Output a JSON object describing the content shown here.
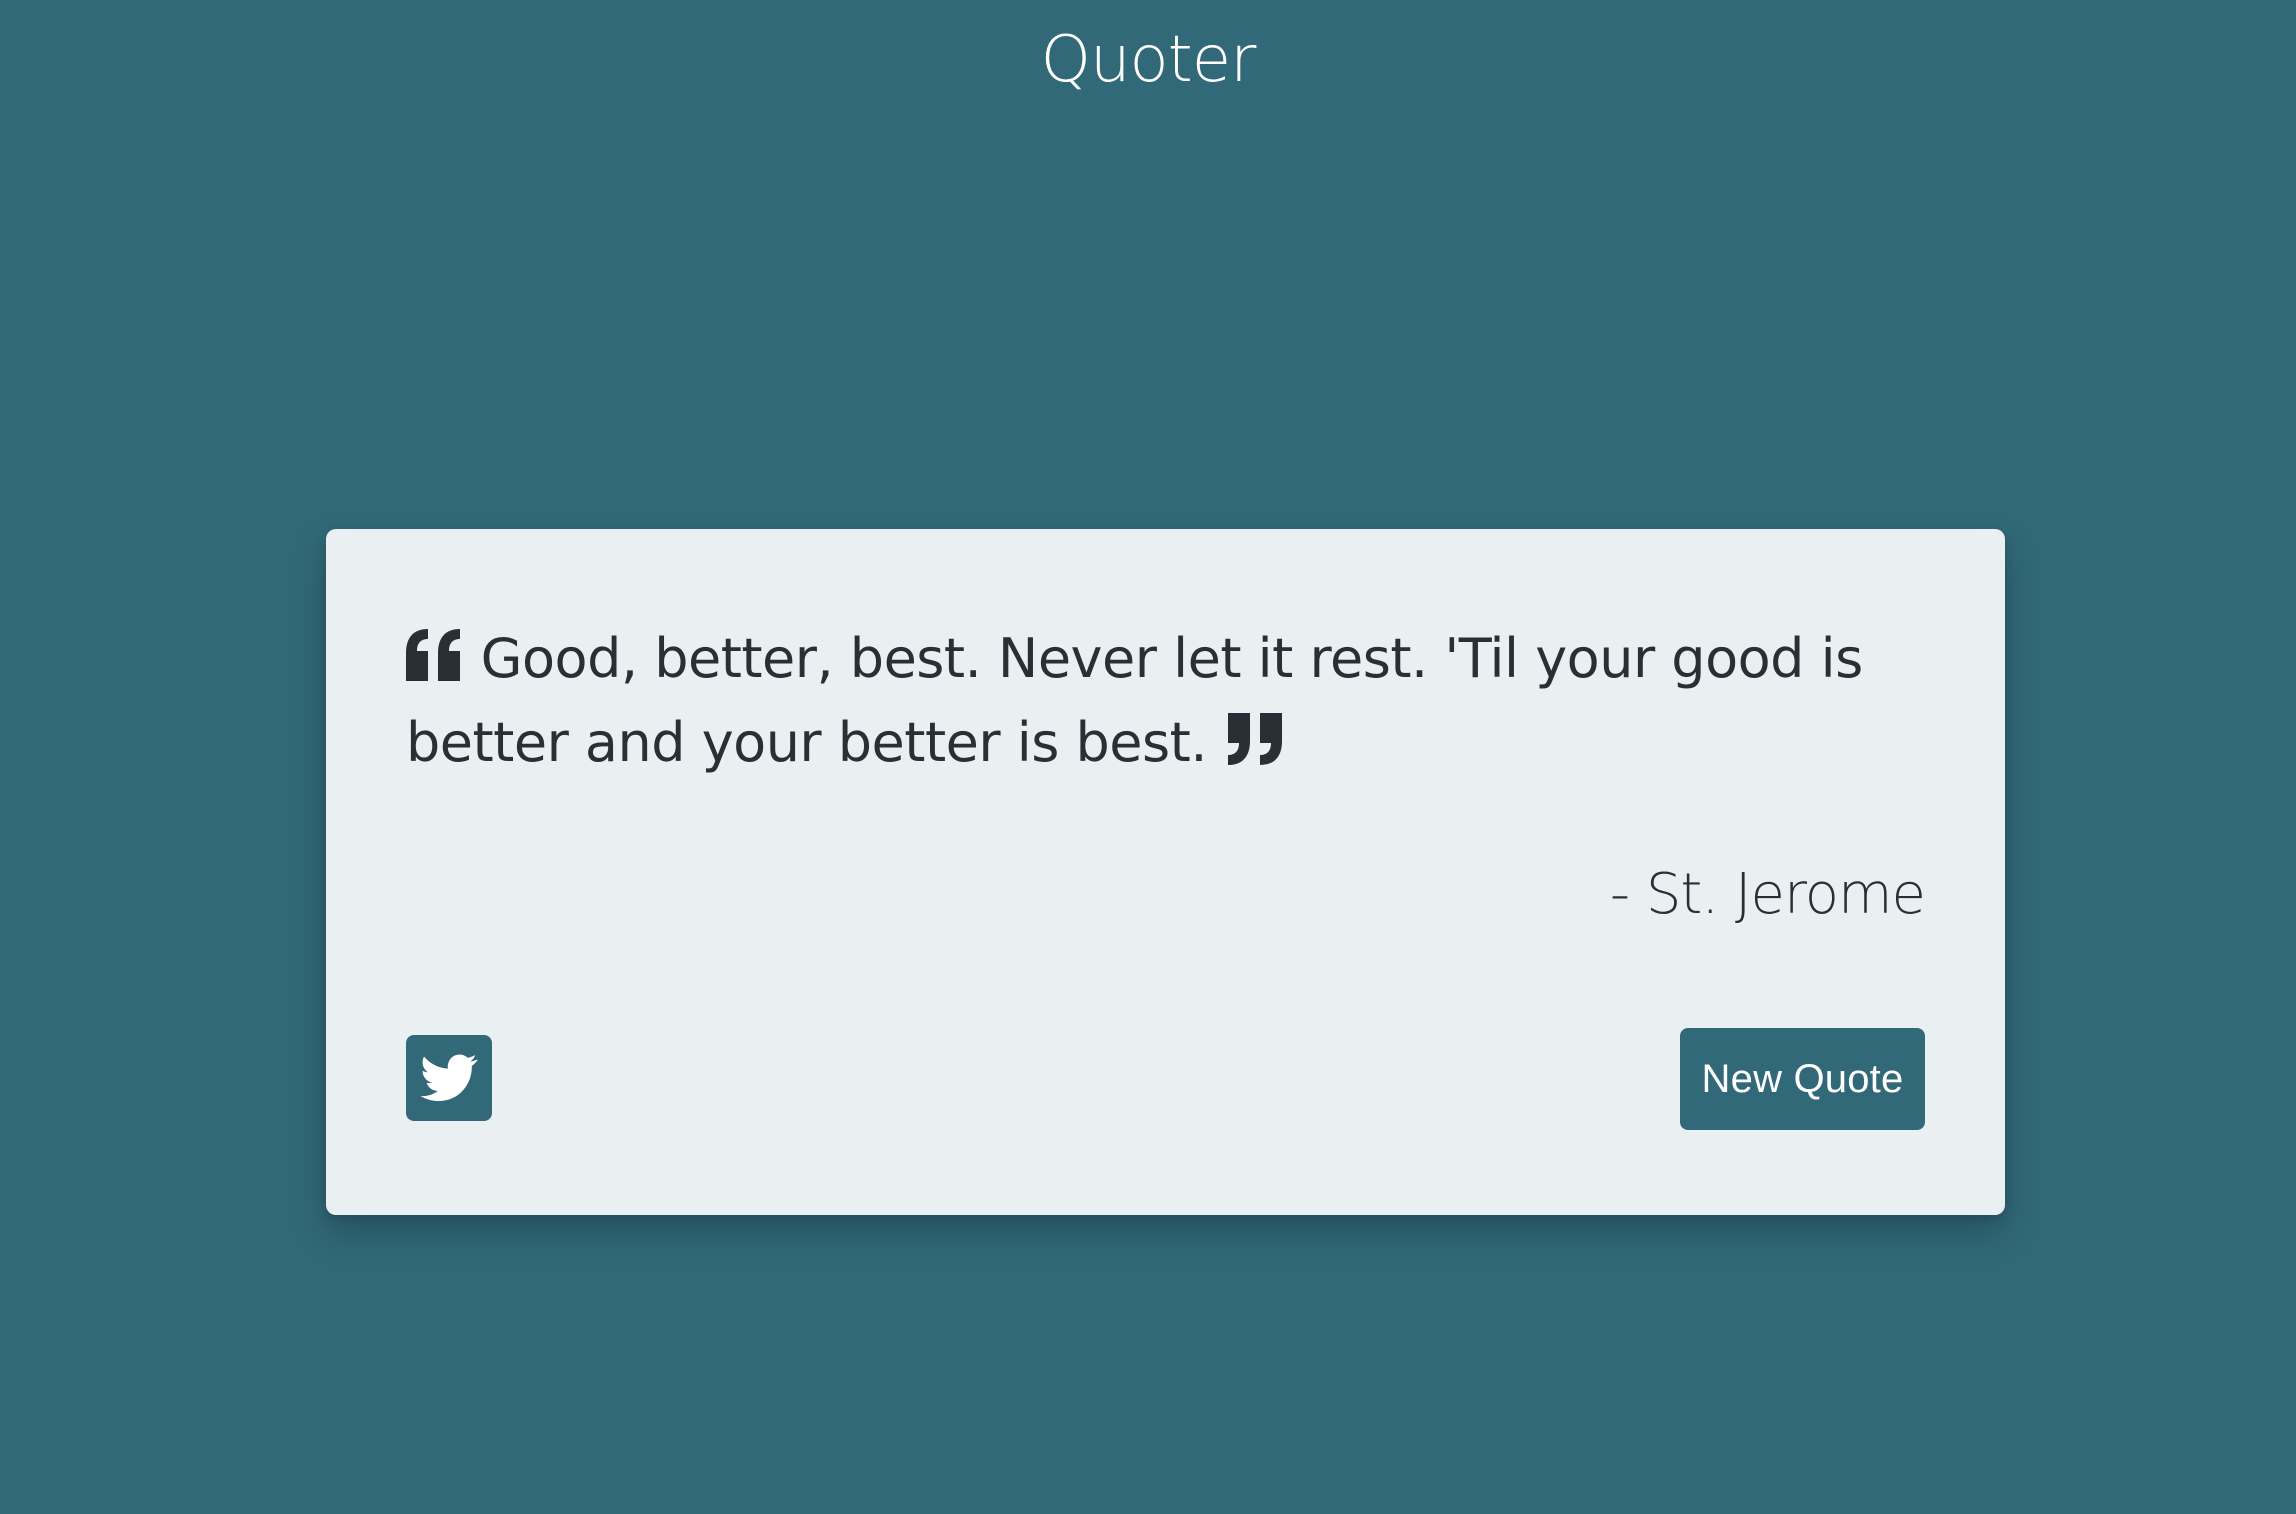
{
  "app": {
    "title": "Quoter"
  },
  "quote": {
    "text": "Good, better, best. Never let it rest. 'Til your good is better and your better is best.",
    "author": "- St. Jerome",
    "open_icon": "quote-left-icon",
    "close_icon": "quote-right-icon"
  },
  "actions": {
    "tweet_icon": "twitter-icon",
    "new_quote_label": "New Quote"
  },
  "colors": {
    "background": "#316979",
    "card": "#eaeff2",
    "text": "#283036",
    "button": "#316979",
    "button_text": "#ffffff"
  }
}
